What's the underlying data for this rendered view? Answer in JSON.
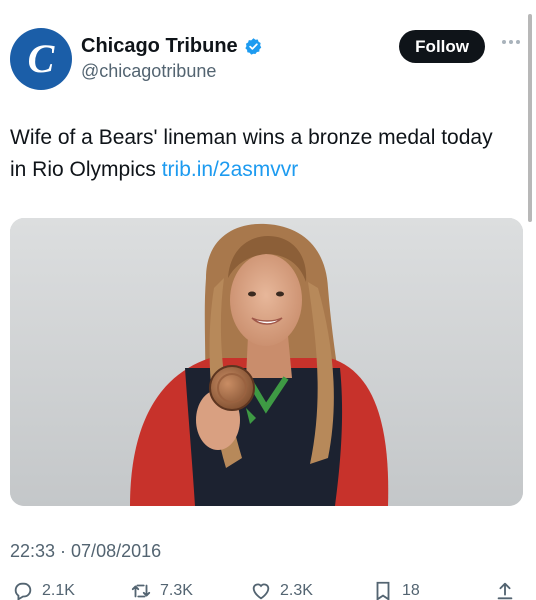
{
  "account": {
    "avatar_letter": "C",
    "display_name": "Chicago Tribune",
    "handle": "@chicagotribune",
    "verified_icon": "verified-badge-icon"
  },
  "follow_label": "Follow",
  "tweet": {
    "text": "Wife of a Bears' lineman wins a bronze medal today in Rio Olympics ",
    "link": "trib.in/2asmvvr",
    "timestamp": "22:33 · 07/08/2016"
  },
  "actions": {
    "replies": "2.1K",
    "retweets": "7.3K",
    "likes": "2.3K",
    "bookmarks": "18"
  },
  "colors": {
    "accent": "#1d9bf0",
    "brand_avatar": "#1b5ea8",
    "follow_bg": "#0f1419"
  }
}
